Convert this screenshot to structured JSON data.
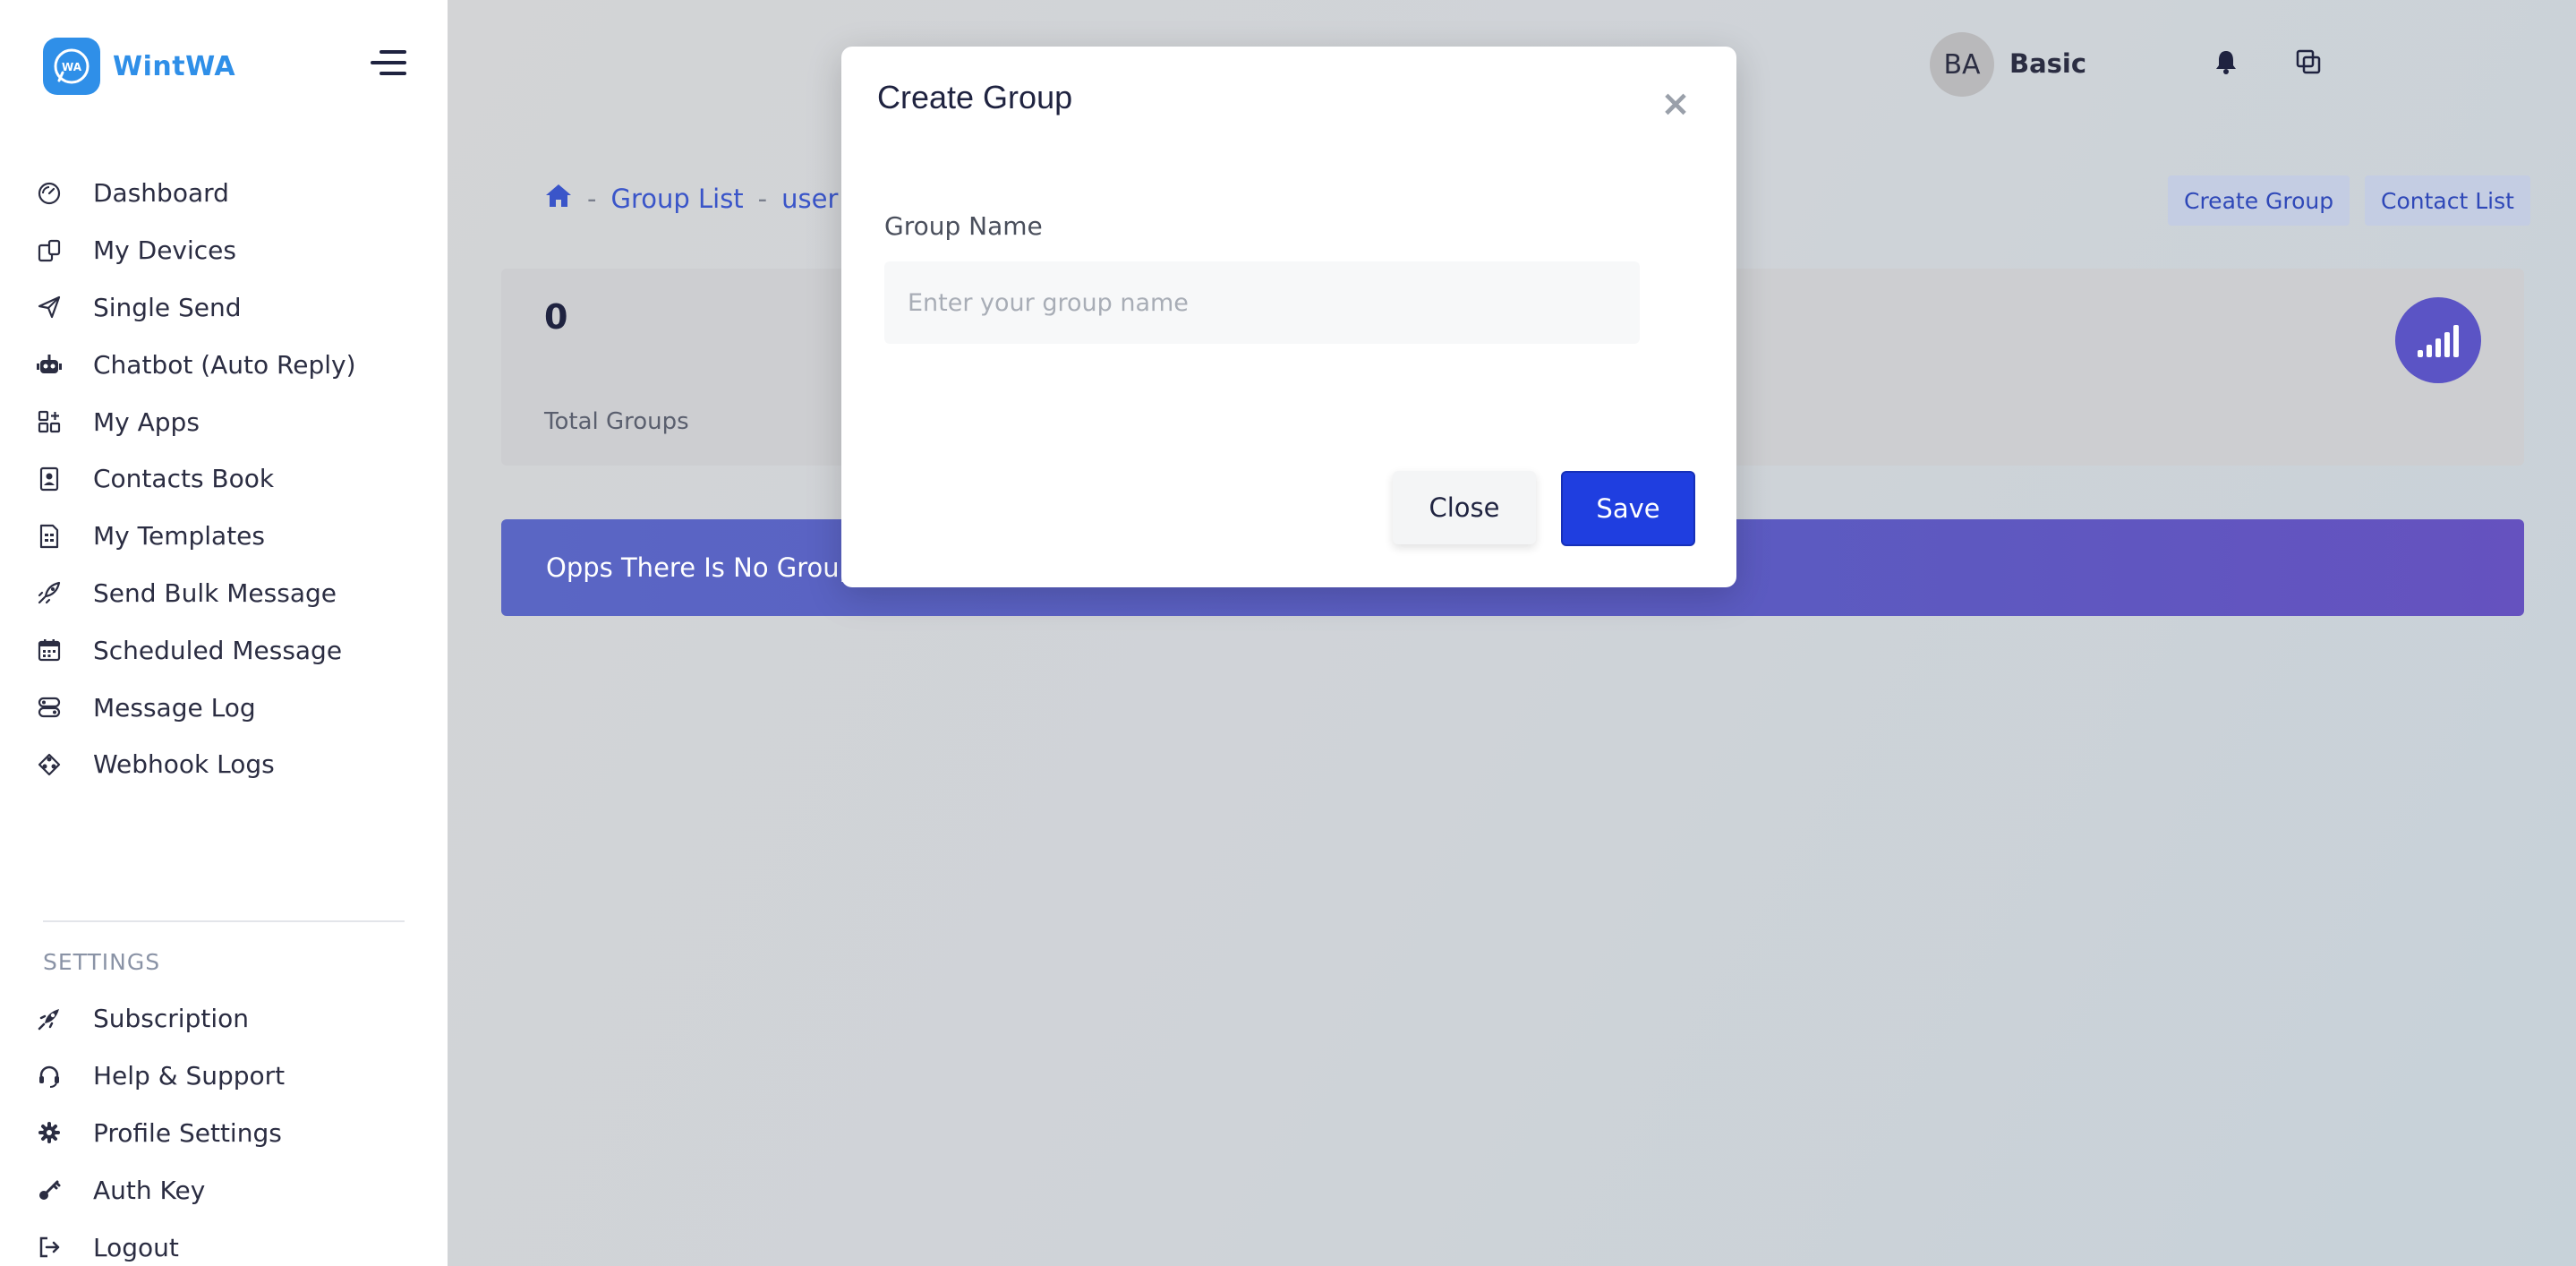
{
  "brand": {
    "name": "WintWA",
    "logo_mark": "WA"
  },
  "sidebar": {
    "items": [
      {
        "label": "Dashboard",
        "icon": "dashboard-gauge-icon"
      },
      {
        "label": "My Devices",
        "icon": "devices-icon"
      },
      {
        "label": "Single Send",
        "icon": "paper-plane-icon"
      },
      {
        "label": "Chatbot (Auto Reply)",
        "icon": "robot-icon"
      },
      {
        "label": "My Apps",
        "icon": "apps-grid-icon"
      },
      {
        "label": "Contacts Book",
        "icon": "contact-book-icon"
      },
      {
        "label": "My Templates",
        "icon": "template-document-icon"
      },
      {
        "label": "Send Bulk Message",
        "icon": "rocket-icon"
      },
      {
        "label": "Scheduled Message",
        "icon": "calendar-icon"
      },
      {
        "label": "Message Log",
        "icon": "message-log-icon"
      },
      {
        "label": "Webhook Logs",
        "icon": "webhook-icon"
      }
    ],
    "settings_title": "SETTINGS",
    "settings_items": [
      {
        "label": "Subscription",
        "icon": "subscription-rocket-icon"
      },
      {
        "label": "Help & Support",
        "icon": "headset-icon"
      },
      {
        "label": "Profile Settings",
        "icon": "gear-icon"
      },
      {
        "label": "Auth Key",
        "icon": "key-icon"
      },
      {
        "label": "Logout",
        "icon": "logout-icon"
      }
    ]
  },
  "topbar": {
    "avatar_initials": "BA",
    "user_name": "Basic"
  },
  "breadcrumb": {
    "items": [
      "Group List",
      "user"
    ]
  },
  "actions": {
    "create_group": "Create Group",
    "contact_list": "Contact List"
  },
  "stats": {
    "total_groups_value": "0",
    "total_groups_label": "Total Groups"
  },
  "alert": {
    "text": "Opps There Is No Groups Found...."
  },
  "modal": {
    "title": "Create Group",
    "close_symbol": "×",
    "field_label": "Group Name",
    "field_placeholder": "Enter your group name",
    "field_value": "",
    "close_label": "Close",
    "save_label": "Save"
  },
  "colors": {
    "primary": "#1f3ee0",
    "brand": "#2f8fe8",
    "alert": "#5a66c4",
    "badge": "#5b54c5"
  }
}
